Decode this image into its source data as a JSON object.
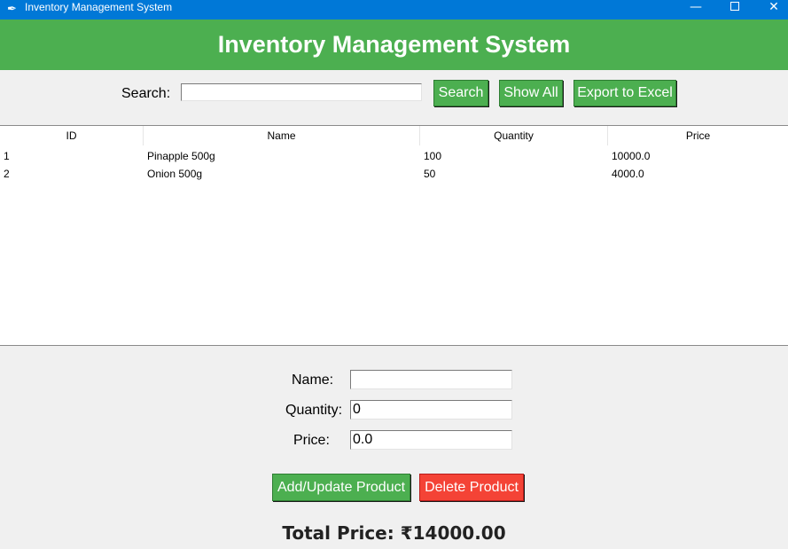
{
  "window": {
    "title": "Inventory Management System",
    "app_icon": "feather-icon",
    "min_glyph": "—",
    "close_glyph": "✕"
  },
  "header": {
    "title": "Inventory Management System"
  },
  "search": {
    "label": "Search:",
    "value": "",
    "search_button": "Search",
    "show_all_button": "Show All",
    "export_button": "Export to Excel"
  },
  "table": {
    "columns": [
      "ID",
      "Name",
      "Quantity",
      "Price"
    ],
    "rows": [
      [
        "1",
        "Pinapple 500g",
        "100",
        "10000.0"
      ],
      [
        "2",
        "Onion 500g",
        "50",
        "4000.0"
      ]
    ]
  },
  "form": {
    "name_label": "Name:",
    "name_value": "",
    "quantity_label": "Quantity:",
    "quantity_value": "0",
    "price_label": "Price:",
    "price_value": "0.0",
    "add_button": "Add/Update Product",
    "delete_button": "Delete Product"
  },
  "total": {
    "text": "Total Price: ₹14000.00"
  },
  "colors": {
    "titlebar": "#0078d7",
    "header": "#4caf50",
    "primary_button": "#4caf50",
    "danger_button": "#f44336"
  }
}
